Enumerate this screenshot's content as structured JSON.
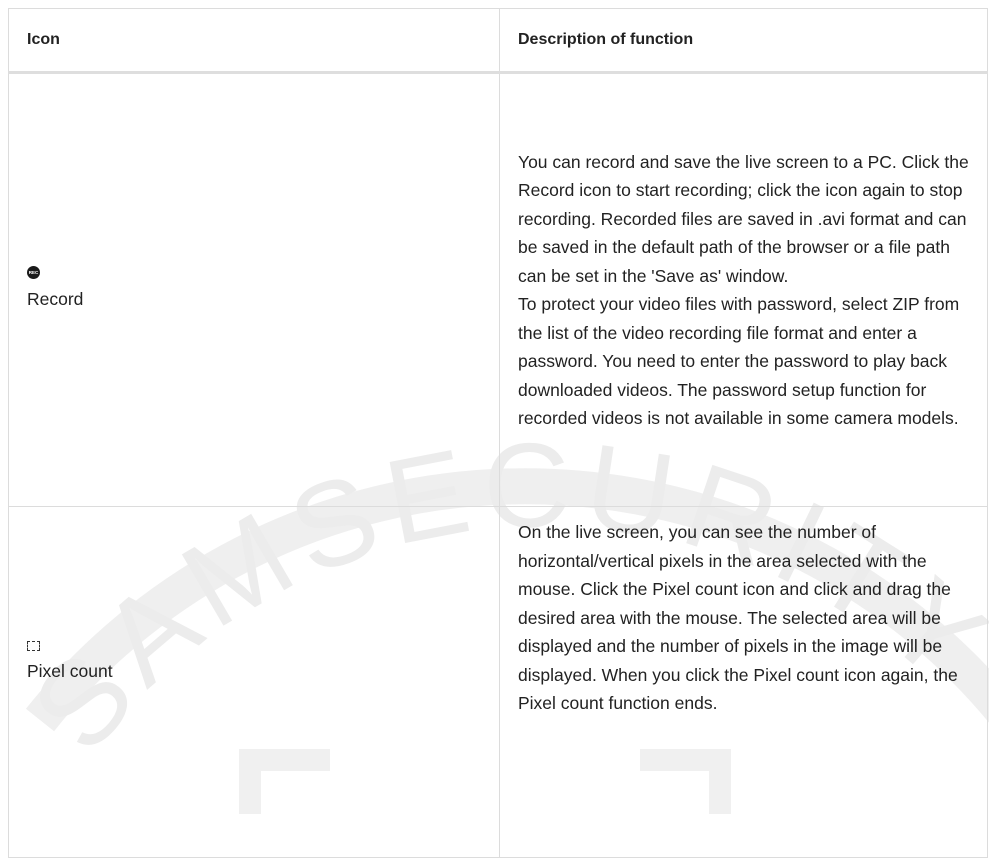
{
  "header": {
    "icon_col": "Icon",
    "desc_col": "Description of function"
  },
  "rows": [
    {
      "icon_name": "record-icon",
      "icon_glyph_text": "REC",
      "icon_label": "Record",
      "description": [
        "You can record and save the live screen to a PC. Click the Record icon to start recording; click the icon again to stop recording. Recorded files are saved in .avi format and can be saved in the default path of the browser or a file path can be set in the 'Save as' window.",
        "To protect your video files with password, select ZIP from the list of the video recording file format and enter a password. You need to enter the password to play back downloaded videos. The password setup function for recorded videos is not available in some camera models."
      ]
    },
    {
      "icon_name": "pixel-count-icon",
      "icon_label": "Pixel count",
      "description": [
        "On the live screen, you can see the number of horizontal/vertical pixels in the area selected with the mouse. Click the Pixel count icon and click and drag the desired area with the mouse. The selected area will be displayed and the number of pixels in the image will be displayed. When you click the Pixel count icon again, the Pixel count function ends."
      ]
    }
  ],
  "watermark_text": "SAMSECURITY",
  "colors": {
    "border": "#dcdcdc",
    "watermark": "#ededed",
    "text": "#222222"
  }
}
